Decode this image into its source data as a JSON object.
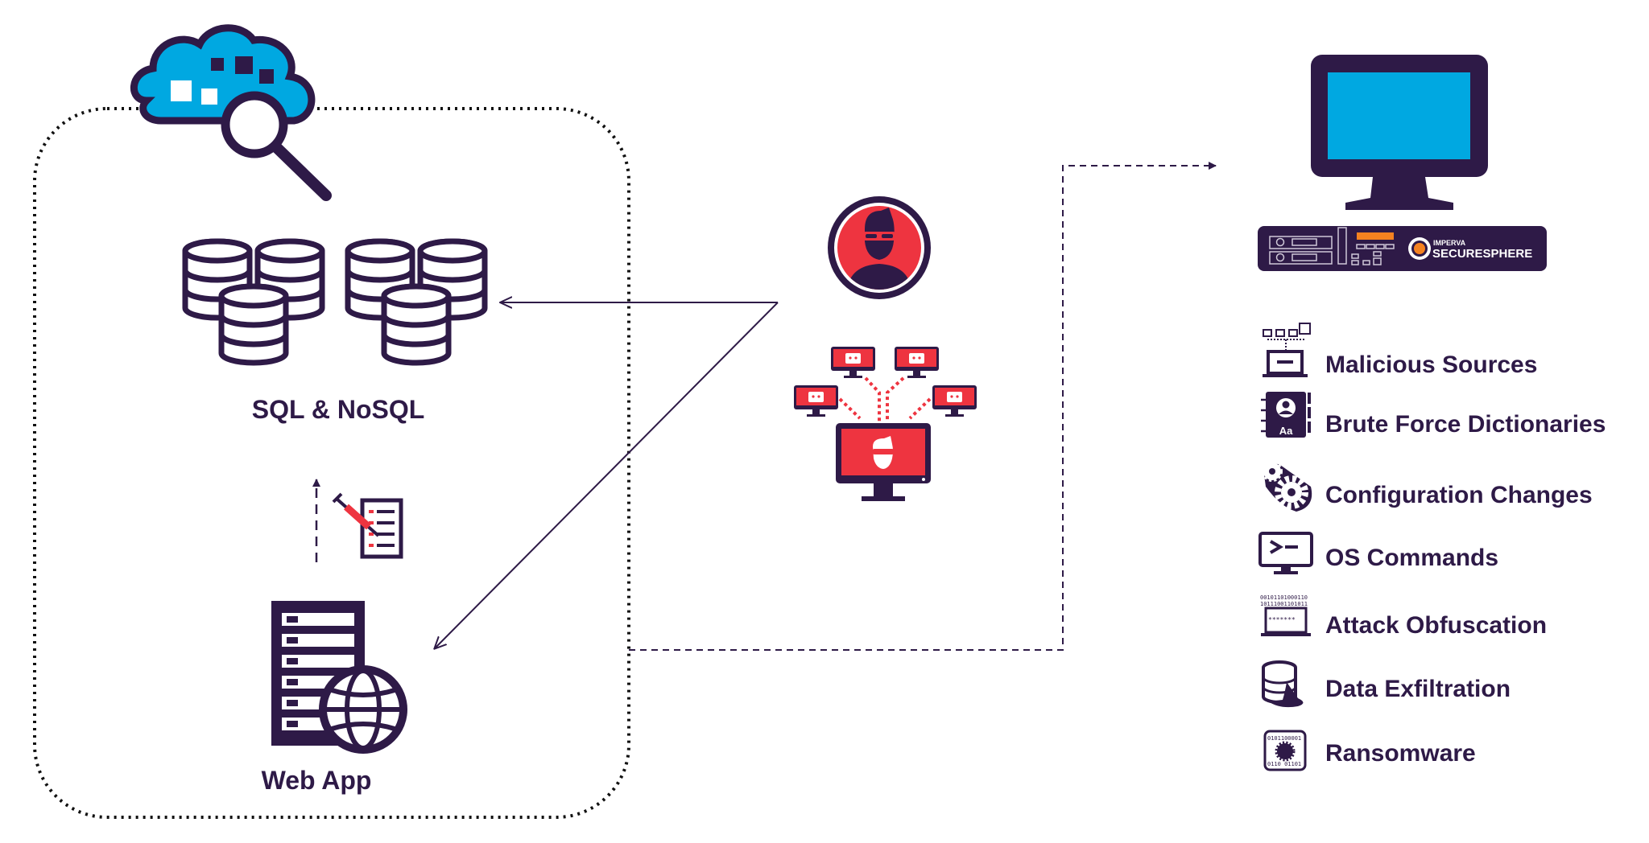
{
  "colors": {
    "primary": "#2e1a47",
    "accent_blue": "#00a8e1",
    "accent_red": "#ee3440",
    "accent_orange": "#f58220"
  },
  "left_zone": {
    "database_label": "SQL & NoSQL",
    "webapp_label": "Web App",
    "icons": [
      "cloud-search-icon",
      "database-icon",
      "sql-injection-icon",
      "web-server-icon",
      "globe-icon"
    ]
  },
  "center": {
    "icons": [
      "hacker-icon",
      "botnet-icon"
    ]
  },
  "right_zone": {
    "appliance_brand": "IMPERVA",
    "appliance_product": "SECURESPHERE",
    "threats": [
      {
        "label": "Malicious Sources",
        "icon": "malicious-sources-icon"
      },
      {
        "label": "Brute Force Dictionaries",
        "icon": "address-book-icon"
      },
      {
        "label": "Configuration Changes",
        "icon": "gears-icon"
      },
      {
        "label": "OS Commands",
        "icon": "terminal-icon"
      },
      {
        "label": "Attack Obfuscation",
        "icon": "obfuscated-laptop-icon"
      },
      {
        "label": "Data Exfiltration",
        "icon": "leaking-database-icon"
      },
      {
        "label": "Ransomware",
        "icon": "ransomware-icon"
      }
    ]
  }
}
